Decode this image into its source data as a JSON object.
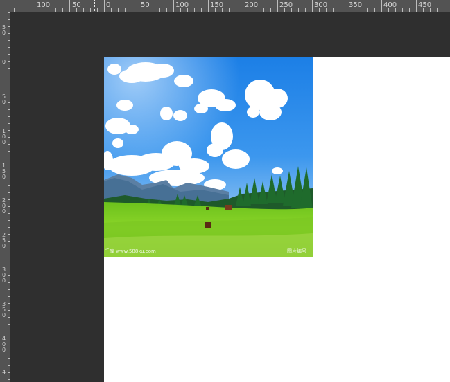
{
  "ruler": {
    "top_labels": [
      {
        "text": "100"
      },
      {
        "text": "50"
      },
      {
        "text": "0"
      },
      {
        "text": "50"
      },
      {
        "text": "100"
      },
      {
        "text": "150"
      },
      {
        "text": "200"
      },
      {
        "text": "250"
      },
      {
        "text": "300"
      },
      {
        "text": "350"
      },
      {
        "text": "400"
      },
      {
        "text": "450"
      }
    ],
    "left_labels": [
      "5\n0",
      "0",
      "5\n0",
      "1\n0\n0",
      "1\n5\n0",
      "2\n0\n0",
      "2\n5\n0",
      "3\n0\n0",
      "3\n5\n0",
      "4\n0\n0",
      "4"
    ]
  },
  "canvas": {
    "document_background": "#ffffff",
    "workspace_background": "#2f2f2f"
  },
  "image": {
    "watermark_left": "千库 www.588ku.com",
    "watermark_right": "图片编号"
  }
}
